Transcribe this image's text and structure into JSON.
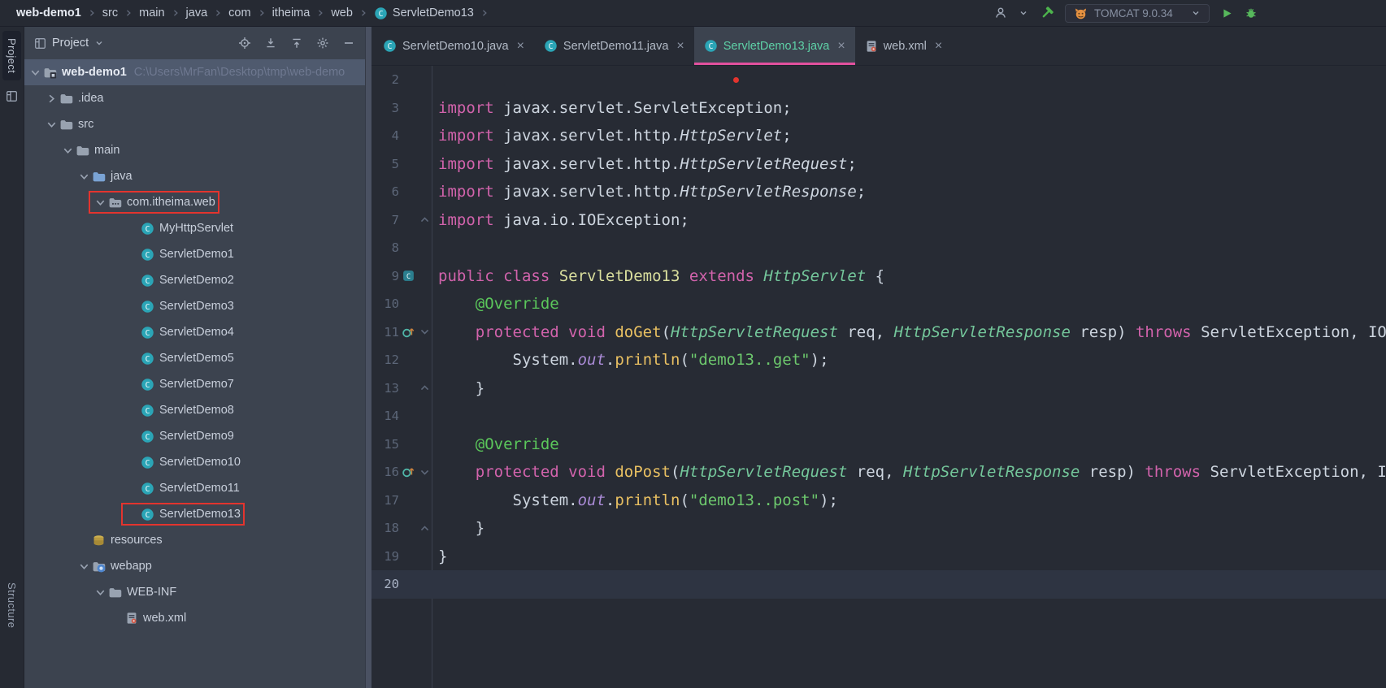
{
  "colors": {
    "accent_pink": "#e2519e",
    "annotation_red": "#e3342e",
    "run_green": "#57b85c",
    "class_icon_teal": "#2ba5b6",
    "keyword_pink": "#d263ac",
    "string_green": "#6dc86d"
  },
  "topbar": {
    "breadcrumbs": [
      "web-demo1",
      "src",
      "main",
      "java",
      "com",
      "itheima",
      "web",
      "ServletDemo13"
    ],
    "run_config": {
      "label": "TOMCAT 9.0.34"
    }
  },
  "stripe": {
    "top_tab": "Project",
    "bottom_tab": "Structure"
  },
  "project_panel": {
    "header": {
      "title": "Project"
    },
    "tree": [
      {
        "label": "web-demo1",
        "path": "C:\\Users\\MrFan\\Desktop\\tmp\\web-demo",
        "depth": 0,
        "chevron": "open",
        "icon": "project-folder",
        "selected": true,
        "bold": true
      },
      {
        "label": ".idea",
        "depth": 1,
        "chevron": "closed",
        "icon": "folder"
      },
      {
        "label": "src",
        "depth": 1,
        "chevron": "open",
        "icon": "folder"
      },
      {
        "label": "main",
        "depth": 2,
        "chevron": "open",
        "icon": "folder"
      },
      {
        "label": "java",
        "depth": 3,
        "chevron": "open",
        "icon": "folder-java"
      },
      {
        "label": "com.itheima.web",
        "depth": 4,
        "chevron": "open",
        "icon": "package",
        "annotated": true
      },
      {
        "label": "MyHttpServlet",
        "depth": 6,
        "chevron": "none",
        "icon": "class"
      },
      {
        "label": "ServletDemo1",
        "depth": 6,
        "chevron": "none",
        "icon": "class"
      },
      {
        "label": "ServletDemo2",
        "depth": 6,
        "chevron": "none",
        "icon": "class"
      },
      {
        "label": "ServletDemo3",
        "depth": 6,
        "chevron": "none",
        "icon": "class"
      },
      {
        "label": "ServletDemo4",
        "depth": 6,
        "chevron": "none",
        "icon": "class"
      },
      {
        "label": "ServletDemo5",
        "depth": 6,
        "chevron": "none",
        "icon": "class"
      },
      {
        "label": "ServletDemo7",
        "depth": 6,
        "chevron": "none",
        "icon": "class"
      },
      {
        "label": "ServletDemo8",
        "depth": 6,
        "chevron": "none",
        "icon": "class"
      },
      {
        "label": "ServletDemo9",
        "depth": 6,
        "chevron": "none",
        "icon": "class"
      },
      {
        "label": "ServletDemo10",
        "depth": 6,
        "chevron": "none",
        "icon": "class"
      },
      {
        "label": "ServletDemo11",
        "depth": 6,
        "chevron": "none",
        "icon": "class"
      },
      {
        "label": "ServletDemo13",
        "depth": 6,
        "chevron": "none",
        "icon": "class",
        "annotated": true
      },
      {
        "label": "resources",
        "depth": 3,
        "chevron": "none",
        "icon": "folder-resources"
      },
      {
        "label": "webapp",
        "depth": 3,
        "chevron": "open",
        "icon": "folder-web"
      },
      {
        "label": "WEB-INF",
        "depth": 4,
        "chevron": "open",
        "icon": "folder"
      },
      {
        "label": "web.xml",
        "depth": 5,
        "chevron": "none",
        "icon": "xml-file"
      }
    ]
  },
  "editor": {
    "close_glyph": "×",
    "tabs": [
      {
        "label": "ServletDemo10.java",
        "icon": "class",
        "active": false
      },
      {
        "label": "ServletDemo11.java",
        "icon": "class",
        "active": false
      },
      {
        "label": "ServletDemo13.java",
        "icon": "class",
        "active": true
      },
      {
        "label": "web.xml",
        "icon": "xml-file",
        "active": false
      }
    ],
    "lines": [
      {
        "n": 2,
        "segs": []
      },
      {
        "n": 3,
        "segs": [
          {
            "t": "import ",
            "c": "kw"
          },
          {
            "t": "javax.servlet.ServletException;",
            "c": "pl"
          }
        ]
      },
      {
        "n": 4,
        "segs": [
          {
            "t": "import ",
            "c": "kw"
          },
          {
            "t": "javax.servlet.http.",
            "c": "pl"
          },
          {
            "t": "HttpServlet",
            "c": "it"
          },
          {
            "t": ";",
            "c": "pl"
          }
        ]
      },
      {
        "n": 5,
        "segs": [
          {
            "t": "import ",
            "c": "kw"
          },
          {
            "t": "javax.servlet.http.",
            "c": "pl"
          },
          {
            "t": "HttpServletRequest",
            "c": "it"
          },
          {
            "t": ";",
            "c": "pl"
          }
        ]
      },
      {
        "n": 6,
        "segs": [
          {
            "t": "import ",
            "c": "kw"
          },
          {
            "t": "javax.servlet.http.",
            "c": "pl"
          },
          {
            "t": "HttpServletResponse",
            "c": "it"
          },
          {
            "t": ";",
            "c": "pl"
          }
        ]
      },
      {
        "n": 7,
        "fold": "up",
        "segs": [
          {
            "t": "import ",
            "c": "kw"
          },
          {
            "t": "java.io.IOException;",
            "c": "pl"
          }
        ]
      },
      {
        "n": 8,
        "segs": []
      },
      {
        "n": 9,
        "gutter": "class",
        "segs": [
          {
            "t": "public class ",
            "c": "kw"
          },
          {
            "t": "ServletDemo13 ",
            "c": "cd"
          },
          {
            "t": "extends ",
            "c": "kw"
          },
          {
            "t": "HttpServlet ",
            "c": "cr"
          },
          {
            "t": "{",
            "c": "pl"
          }
        ]
      },
      {
        "n": 10,
        "segs": [
          {
            "t": "    ",
            "c": "pl"
          },
          {
            "t": "@Override",
            "c": "an"
          }
        ]
      },
      {
        "n": 11,
        "gutter": "override",
        "fold": "down",
        "segs": [
          {
            "t": "    ",
            "c": "pl"
          },
          {
            "t": "protected void ",
            "c": "kw"
          },
          {
            "t": "doGet",
            "c": "mt"
          },
          {
            "t": "(",
            "c": "pl"
          },
          {
            "t": "HttpServletRequest",
            "c": "cr"
          },
          {
            "t": " req, ",
            "c": "pl"
          },
          {
            "t": "HttpServletResponse",
            "c": "cr"
          },
          {
            "t": " resp) ",
            "c": "pl"
          },
          {
            "t": "throws ",
            "c": "kw"
          },
          {
            "t": "ServletException, IO",
            "c": "pl"
          }
        ]
      },
      {
        "n": 12,
        "segs": [
          {
            "t": "        System.",
            "c": "pl"
          },
          {
            "t": "out",
            "c": "fd"
          },
          {
            "t": ".",
            "c": "pl"
          },
          {
            "t": "println",
            "c": "mt"
          },
          {
            "t": "(",
            "c": "pl"
          },
          {
            "t": "\"demo13..get\"",
            "c": "st"
          },
          {
            "t": ");",
            "c": "pl"
          }
        ]
      },
      {
        "n": 13,
        "fold": "up",
        "segs": [
          {
            "t": "    }",
            "c": "pl"
          }
        ]
      },
      {
        "n": 14,
        "segs": []
      },
      {
        "n": 15,
        "segs": [
          {
            "t": "    ",
            "c": "pl"
          },
          {
            "t": "@Override",
            "c": "an"
          }
        ]
      },
      {
        "n": 16,
        "gutter": "override",
        "fold": "down",
        "segs": [
          {
            "t": "    ",
            "c": "pl"
          },
          {
            "t": "protected void ",
            "c": "kw"
          },
          {
            "t": "doPost",
            "c": "mt"
          },
          {
            "t": "(",
            "c": "pl"
          },
          {
            "t": "HttpServletRequest",
            "c": "cr"
          },
          {
            "t": " req, ",
            "c": "pl"
          },
          {
            "t": "HttpServletResponse",
            "c": "cr"
          },
          {
            "t": " resp) ",
            "c": "pl"
          },
          {
            "t": "throws ",
            "c": "kw"
          },
          {
            "t": "ServletException, I",
            "c": "pl"
          }
        ]
      },
      {
        "n": 17,
        "segs": [
          {
            "t": "        System.",
            "c": "pl"
          },
          {
            "t": "out",
            "c": "fd"
          },
          {
            "t": ".",
            "c": "pl"
          },
          {
            "t": "println",
            "c": "mt"
          },
          {
            "t": "(",
            "c": "pl"
          },
          {
            "t": "\"demo13..post\"",
            "c": "st"
          },
          {
            "t": ");",
            "c": "pl"
          }
        ]
      },
      {
        "n": 18,
        "fold": "up",
        "segs": [
          {
            "t": "    }",
            "c": "pl"
          }
        ]
      },
      {
        "n": 19,
        "segs": [
          {
            "t": "}",
            "c": "pl"
          }
        ]
      },
      {
        "n": 20,
        "current": true,
        "segs": []
      }
    ]
  },
  "annotations": {
    "highlight_boxes": [
      "com.itheima.web",
      "ServletDemo13"
    ],
    "tab_marker_dot": true
  }
}
